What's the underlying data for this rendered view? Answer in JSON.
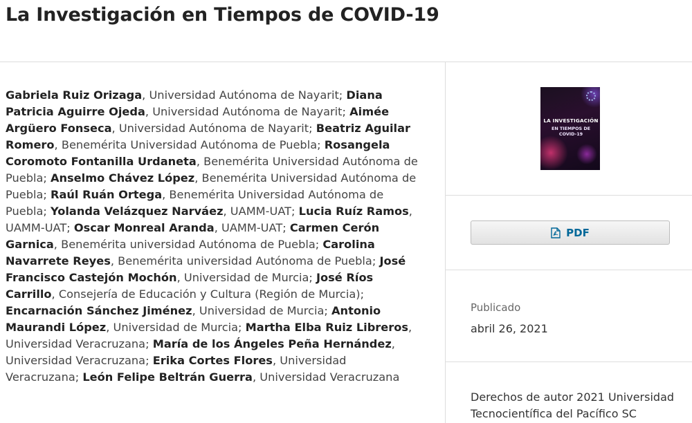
{
  "page": {
    "title": "La Investigación en Tiempos de COVID-19"
  },
  "authors": [
    {
      "name": "Gabriela Ruiz Orizaga",
      "affiliation": ", Universidad Autónoma de Nayarit; "
    },
    {
      "name": "Diana Patricia Aguirre Ojeda",
      "affiliation": ", Universidad Autónoma de Nayarit; "
    },
    {
      "name": "Aimée Argüero Fonseca",
      "affiliation": ", Universidad Autónoma de Nayarit; "
    },
    {
      "name": "Beatriz Aguilar Romero",
      "affiliation": ", Benemérita Universidad Autónoma de Puebla; "
    },
    {
      "name": "Rosangela Coromoto Fontanilla Urdaneta",
      "affiliation": ", Benemérita Universidad Autónoma de Puebla; "
    },
    {
      "name": "Anselmo Chávez López",
      "affiliation": ", Benemérita Universidad Autónoma de Puebla; "
    },
    {
      "name": "Raúl Ruán Ortega",
      "affiliation": ", Benemérita Universidad Autónoma de Puebla; "
    },
    {
      "name": "Yolanda Velázquez Narváez",
      "affiliation": ", UAMM-UAT; "
    },
    {
      "name": "Lucia Ruíz Ramos",
      "affiliation": ", UAMM-UAT; "
    },
    {
      "name": "Oscar Monreal Aranda",
      "affiliation": ", UAMM-UAT; "
    },
    {
      "name": "Carmen Cerón Garnica",
      "affiliation": ", Benemérita universidad Autónoma de Puebla; "
    },
    {
      "name": "Carolina Navarrete Reyes",
      "affiliation": ", Benemérita universidad Autónoma de Puebla; "
    },
    {
      "name": "José Francisco Castejón Mochón",
      "affiliation": ", Universidad de Murcia; "
    },
    {
      "name": "José Ríos Carrillo",
      "affiliation": ", Consejería de Educación y Cultura (Región de Murcia); "
    },
    {
      "name": "Encarnación Sánchez Jiménez",
      "affiliation": ", Universidad de Murcia; "
    },
    {
      "name": "Antonio Maurandi López",
      "affiliation": ", Universidad de Murcia; "
    },
    {
      "name": "Martha Elba Ruiz Libreros",
      "affiliation": ", Universidad Veracruzana; "
    },
    {
      "name": "María de los Ángeles Peña Hernández",
      "affiliation": ", Universidad Veracruzana; "
    },
    {
      "name": "Erika Cortes Flores",
      "affiliation": ", Universidad Veracruzana; "
    },
    {
      "name": "León Felipe Beltrán Guerra",
      "affiliation": ", Universidad Veracruzana"
    }
  ],
  "sidebar": {
    "cover": {
      "line1": "LA INVESTIGACIÓN",
      "line2": "EN TIEMPOS DE COVID-19",
      "icon": "book-cover-image"
    },
    "pdf_button": {
      "label": "PDF",
      "icon": "file-pdf-icon"
    },
    "published": {
      "label": "Publicado",
      "date": "abril 26, 2021"
    },
    "rights": "Derechos de autor 2021 Universidad Tecnocientífica del Pacífico SC"
  },
  "colors": {
    "link": "#006798",
    "divider": "#dddddd",
    "title": "#222222"
  }
}
